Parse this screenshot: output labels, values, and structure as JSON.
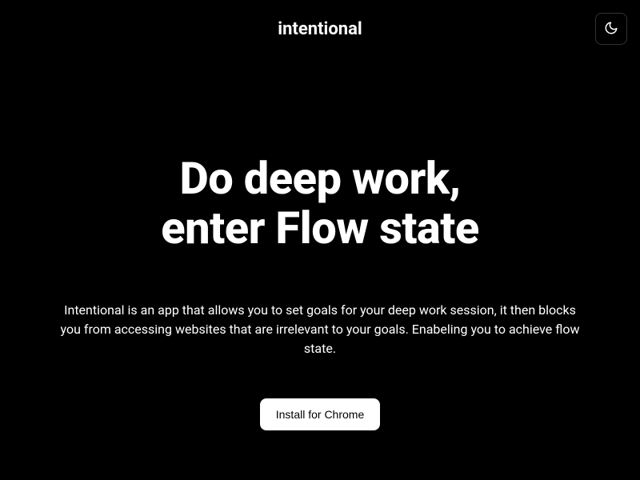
{
  "header": {
    "brand": "intentional"
  },
  "hero": {
    "headline_line1": "Do deep work,",
    "headline_line2": "enter Flow state",
    "description": "Intentional is an app that allows you to set goals for your deep work session, it then blocks you from accessing websites that are irrelevant to your goals. Enabeling you to achieve flow state.",
    "cta_label": "Install for Chrome"
  }
}
